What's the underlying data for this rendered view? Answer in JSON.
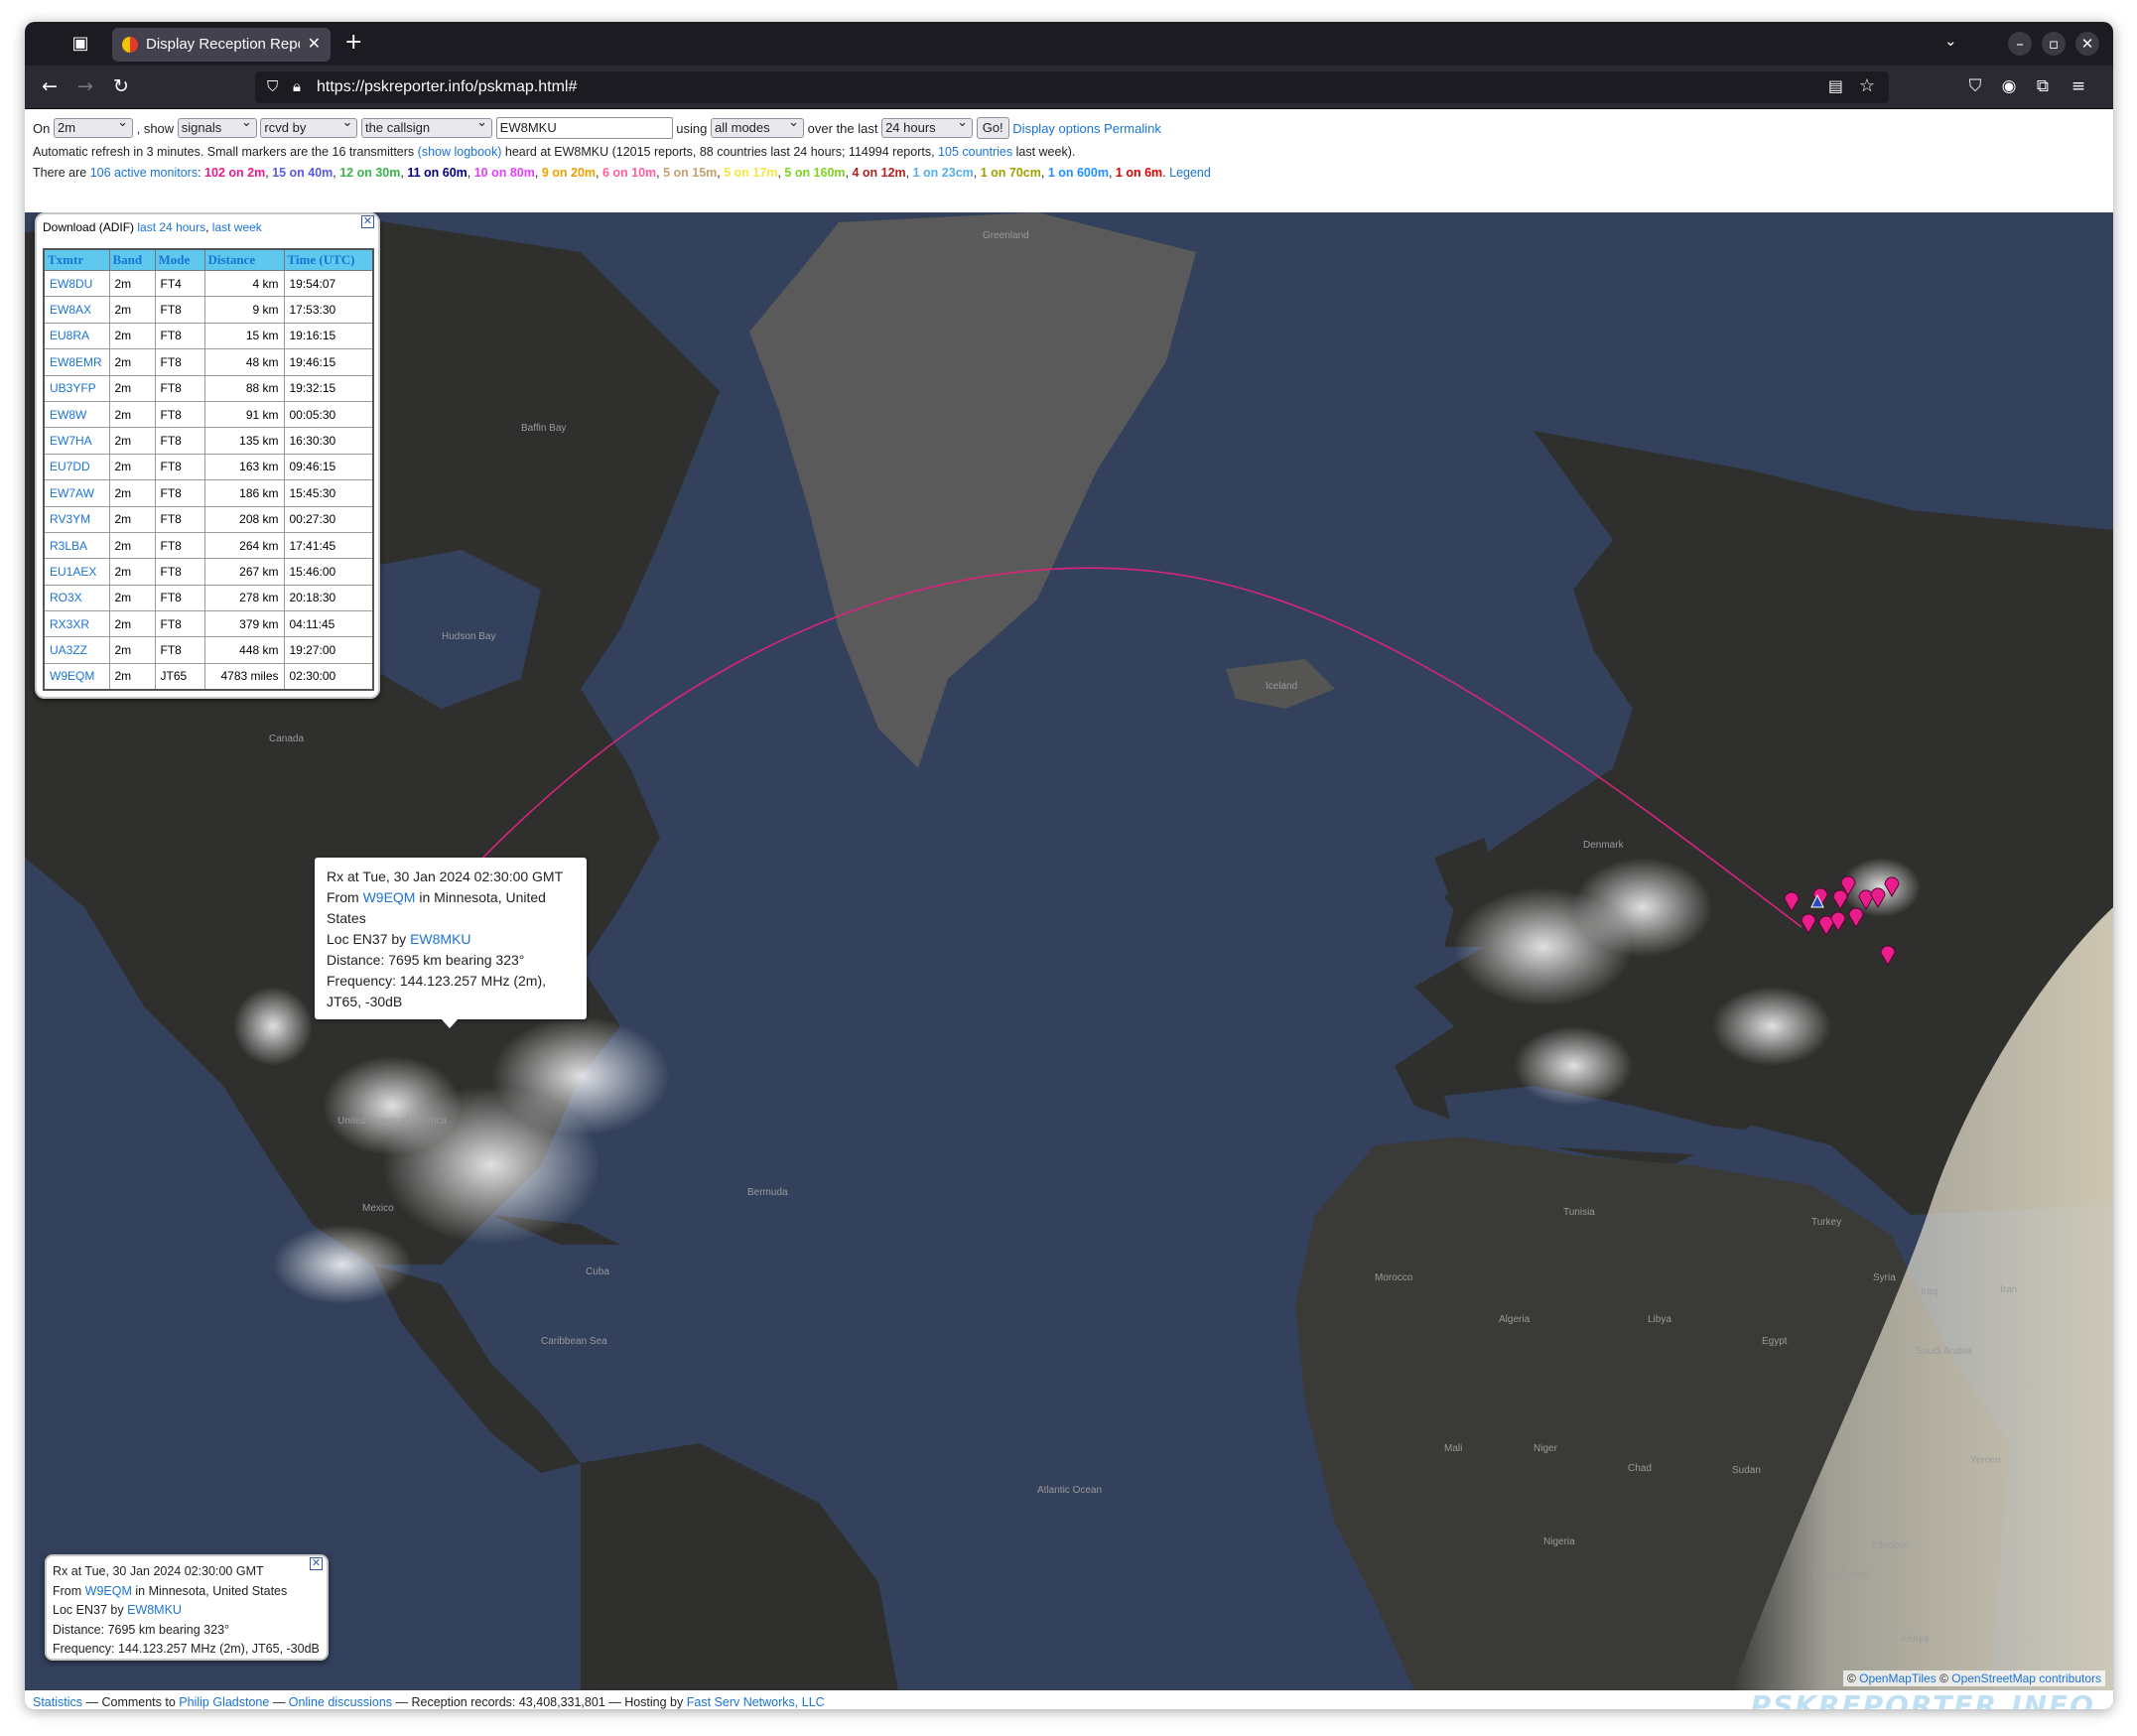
{
  "browser": {
    "tab_title": "Display Reception Reports",
    "url": "https://pskreporter.info/pskmap.html#",
    "new_tab_label": "+",
    "close_label": "✕"
  },
  "controls": {
    "on_label": "On",
    "band_value": "2m",
    "show_label": ", show",
    "show_value": "signals",
    "direction_value": "rcvd by",
    "target_value": "the callsign",
    "callsign_value": "EW8MKU",
    "using_label": "using",
    "mode_value": "all modes",
    "over_label": "over the last",
    "period_value": "24 hours",
    "go_label": "Go!",
    "display_options": "Display options",
    "permalink": "Permalink"
  },
  "status": {
    "line1_a": "Automatic refresh in 3 minutes. Small markers are the 16 transmitters",
    "show_logbook": "(show logbook)",
    "line1_b": "heard at EW8MKU (12015 reports, 88 countries last 24 hours; 114994 reports,",
    "countries_link": "105 countries",
    "line1_c": "last week).",
    "monitors_prefix": "There are",
    "monitors_link": "106 active monitors",
    "monitors_colon": ":",
    "legend": "Legend",
    "bands": [
      {
        "text": "102 on 2m",
        "color": "#e91e8c"
      },
      {
        "text": "15 on 40m",
        "color": "#5b5be0"
      },
      {
        "text": "12 on 30m",
        "color": "#3cb44b"
      },
      {
        "text": "11 on 60m",
        "color": "#000080"
      },
      {
        "text": "10 on 80m",
        "color": "#e040fb"
      },
      {
        "text": "9 on 20m",
        "color": "#f0a000"
      },
      {
        "text": "6 on 10m",
        "color": "#ff5fa0"
      },
      {
        "text": "5 on 15m",
        "color": "#c8a070"
      },
      {
        "text": "5 on 17m",
        "color": "#f5e642"
      },
      {
        "text": "5 on 160m",
        "color": "#7dd322"
      },
      {
        "text": "4 on 12m",
        "color": "#b22222"
      },
      {
        "text": "1 on 23cm",
        "color": "#5aaee6"
      },
      {
        "text": "1 on 70cm",
        "color": "#a0a000"
      },
      {
        "text": "1 on 600m",
        "color": "#1e90ff"
      },
      {
        "text": "1 on 6m",
        "color": "#e00000"
      }
    ]
  },
  "download": {
    "label": "Download (ADIF)",
    "last24": "last 24 hours",
    "sep": ",",
    "lastweek": "last week"
  },
  "table": {
    "headers": [
      "Txmtr",
      "Band",
      "Mode",
      "Distance",
      "Time (UTC)"
    ],
    "rows": [
      [
        "EW8DU",
        "2m",
        "FT4",
        "4 km",
        "19:54:07"
      ],
      [
        "EW8AX",
        "2m",
        "FT8",
        "9 km",
        "17:53:30"
      ],
      [
        "EU8RA",
        "2m",
        "FT8",
        "15 km",
        "19:16:15"
      ],
      [
        "EW8EMR",
        "2m",
        "FT8",
        "48 km",
        "19:46:15"
      ],
      [
        "UB3YFP",
        "2m",
        "FT8",
        "88 km",
        "19:32:15"
      ],
      [
        "EW8W",
        "2m",
        "FT8",
        "91 km",
        "00:05:30"
      ],
      [
        "EW7HA",
        "2m",
        "FT8",
        "135 km",
        "16:30:30"
      ],
      [
        "EU7DD",
        "2m",
        "FT8",
        "163 km",
        "09:46:15"
      ],
      [
        "EW7AW",
        "2m",
        "FT8",
        "186 km",
        "15:45:30"
      ],
      [
        "RV3YM",
        "2m",
        "FT8",
        "208 km",
        "00:27:30"
      ],
      [
        "R3LBA",
        "2m",
        "FT8",
        "264 km",
        "17:41:45"
      ],
      [
        "EU1AEX",
        "2m",
        "FT8",
        "267 km",
        "15:46:00"
      ],
      [
        "RO3X",
        "2m",
        "FT8",
        "278 km",
        "20:18:30"
      ],
      [
        "RX3XR",
        "2m",
        "FT8",
        "379 km",
        "04:11:45"
      ],
      [
        "UA3ZZ",
        "2m",
        "FT8",
        "448 km",
        "19:27:00"
      ],
      [
        "W9EQM",
        "2m",
        "JT65",
        "4783 miles",
        "02:30:00"
      ]
    ]
  },
  "popup": {
    "rx_line": "Rx at Tue, 30 Jan 2024 02:30:00 GMT",
    "from_label": "From",
    "from_call": "W9EQM",
    "from_place": "in Minnesota, United States",
    "loc_label": "Loc EN37 by",
    "loc_call": "EW8MKU",
    "distance": "Distance: 7695 km bearing 323°",
    "frequency": "Frequency: 144.123.257 MHz (2m), JT65, -30dB"
  },
  "map_labels": [
    {
      "text": "Greenland"
    },
    {
      "text": "Iceland"
    },
    {
      "text": "Canada"
    },
    {
      "text": "United States of America"
    },
    {
      "text": "Mexico"
    },
    {
      "text": "Algeria"
    },
    {
      "text": "Libya"
    },
    {
      "text": "Egypt"
    },
    {
      "text": "Saudi Arabia"
    },
    {
      "text": "Mali"
    },
    {
      "text": "Niger"
    },
    {
      "text": "Chad"
    },
    {
      "text": "Sudan"
    },
    {
      "text": "Nigeria"
    },
    {
      "text": "Ethiopia"
    },
    {
      "text": "Morocco"
    },
    {
      "text": "Tunisia"
    },
    {
      "text": "Syria"
    },
    {
      "text": "Iraq"
    },
    {
      "text": "Iran"
    },
    {
      "text": "Turkey"
    },
    {
      "text": "Yemen"
    },
    {
      "text": "Kenya"
    },
    {
      "text": "South Sudan"
    },
    {
      "text": "Hudson Bay"
    },
    {
      "text": "Baffin Bay"
    },
    {
      "text": "Atlantic Ocean"
    },
    {
      "text": "Caribbean Sea"
    },
    {
      "text": "Bermuda"
    },
    {
      "text": "Denmark"
    },
    {
      "text": "Cuba"
    }
  ],
  "attribution": {
    "copy1": "©",
    "openmaptiles": "OpenMapTiles",
    "copy2": "©",
    "osm": "OpenStreetMap contributors"
  },
  "footer": {
    "statistics": "Statistics",
    "comments": "— Comments to",
    "author": "Philip Gladstone",
    "dash1": "—",
    "discussions": "Online discussions",
    "records": "— Reception records: 43,408,331,801 — Hosting by",
    "hosting": "Fast Serv Networks, LLC",
    "brand": "PSKREPORTER.INFO"
  },
  "colors": {
    "marker": "#e91e8c",
    "link": "#1a73d6",
    "table_header": "#5ec8ef",
    "ocean": "#33415c",
    "land": "#2e2e2c"
  }
}
